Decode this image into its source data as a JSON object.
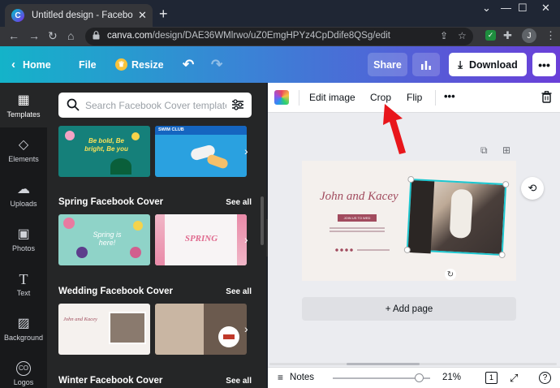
{
  "browser": {
    "tab_title": "Untitled design - Facebook Cover",
    "favicon_letter": "C",
    "url_host": "canva.com",
    "url_path": "/design/DAE36WMlrwo/uZ0EmgHPYz4CpDdife8QSg/edit",
    "avatar_letter": "J"
  },
  "header": {
    "home_label": "Home",
    "file_label": "File",
    "resize_label": "Resize",
    "share_label": "Share",
    "download_label": "Download"
  },
  "rail": {
    "items": [
      {
        "label": "Templates"
      },
      {
        "label": "Elements"
      },
      {
        "label": "Uploads"
      },
      {
        "label": "Photos"
      },
      {
        "label": "Text"
      },
      {
        "label": "Background"
      },
      {
        "label": "Logos"
      }
    ]
  },
  "panel": {
    "search_placeholder": "Search Facebook Cover templates",
    "sections": [
      {
        "title": "Spring Facebook Cover",
        "see_all": "See all"
      },
      {
        "title": "Wedding Facebook Cover",
        "see_all": "See all"
      },
      {
        "title": "Winter Facebook Cover",
        "see_all": "See all"
      }
    ],
    "thumbs": {
      "row1a_text": "Be bold, Be bright, Be you",
      "row1b_text": "SWIM CLUB",
      "spring_a_text": "Spring is here!",
      "spring_b_text": "SPRING",
      "wedding_a_text": "John and Kacey"
    }
  },
  "toolbar": {
    "edit_image": "Edit image",
    "crop": "Crop",
    "flip": "Flip"
  },
  "canvas": {
    "script_title": "John and Kacey",
    "badge_text": "JOIN US TO WED",
    "add_page": "+ Add page"
  },
  "footer": {
    "notes": "Notes",
    "zoom": "21%",
    "page_num": "1"
  },
  "colors": {
    "accent_header_start": "#14b3c9",
    "accent_header_end": "#6a3fd8",
    "annotation_red": "#e8161b",
    "selection": "#1cc7d0"
  }
}
